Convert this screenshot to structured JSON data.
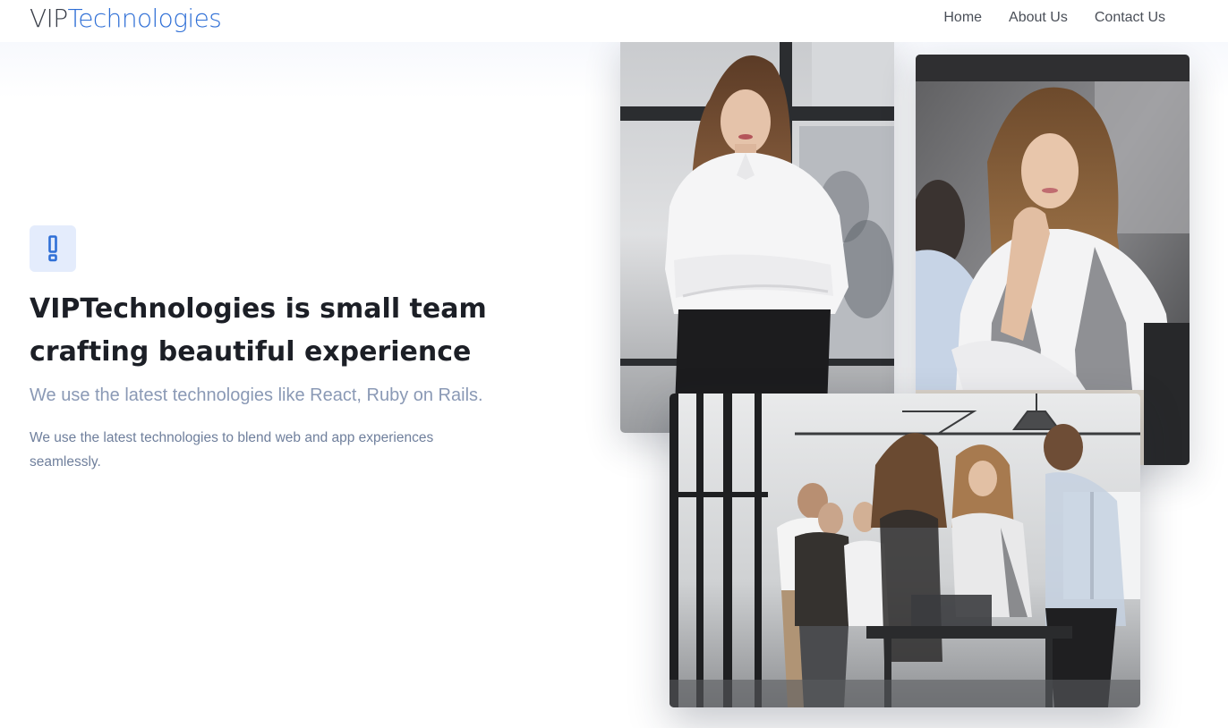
{
  "brand": {
    "part1": "VIP",
    "part2": "Technologies"
  },
  "nav": {
    "items": [
      {
        "label": "Home"
      },
      {
        "label": "About Us"
      },
      {
        "label": "Contact Us"
      }
    ]
  },
  "hero": {
    "icon": "exclamation-icon",
    "headline": "VIPTechnologies is small team crafting beautiful experience",
    "subtitle": "We use the latest technologies like React, Ruby on Rails.",
    "body": "We use the latest technologies to blend web and app experiences seamlessly."
  },
  "gallery": {
    "photos": [
      {
        "name": "woman-arms-crossed-photo"
      },
      {
        "name": "woman-hand-on-chin-photo"
      },
      {
        "name": "team-in-office-photo"
      }
    ]
  },
  "colors": {
    "accent": "#2f6fd6",
    "brand_dark": "#3a3f49",
    "badge_bg": "#e4ecfc",
    "headline": "#1c1f26",
    "muted_text": "#8a99b5"
  }
}
